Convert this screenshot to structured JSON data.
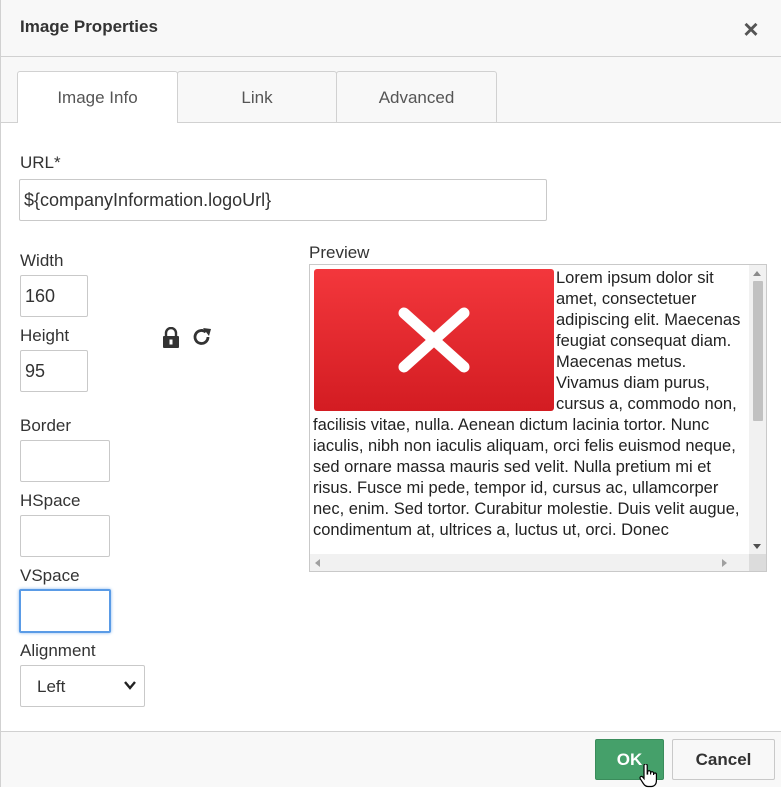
{
  "dialog": {
    "title": "Image Properties",
    "close_symbol": "×"
  },
  "tabs": [
    {
      "label": "Image Info",
      "active": true
    },
    {
      "label": "Link",
      "active": false
    },
    {
      "label": "Advanced",
      "active": false
    }
  ],
  "form": {
    "url_label": "URL",
    "url_required_mark": "*",
    "url_value": "${companyInformation.logoUrl}",
    "width_label": "Width",
    "width_value": "160",
    "height_label": "Height",
    "height_value": "95",
    "border_label": "Border",
    "border_value": "",
    "hspace_label": "HSpace",
    "hspace_value": "",
    "vspace_label": "VSpace",
    "vspace_value": "",
    "alignment_label": "Alignment",
    "alignment_value": "Left",
    "lock_icon": "lock-icon",
    "reset_icon": "reset-size-icon"
  },
  "preview": {
    "label": "Preview",
    "image_icon": "broken-image-x-icon",
    "text": "Lorem ipsum dolor sit amet, consectetuer adipiscing elit. Maecenas feugiat consequat diam. Maecenas metus. Vivamus diam purus, cursus a, commodo non, facilisis vitae, nulla. Aenean dictum lacinia tortor. Nunc iaculis, nibh non iaculis aliquam, orci felis euismod neque, sed ornare massa mauris sed velit. Nulla pretium mi et risus. Fusce mi pede, tempor id, cursus ac, ullamcorper nec, enim. Sed tortor. Curabitur molestie. Duis velit augue, condimentum at, ultrices a, luctus ut, orci. Donec"
  },
  "footer": {
    "ok_label": "OK",
    "cancel_label": "Cancel"
  },
  "colors": {
    "ok_button": "#45a06a",
    "focus_ring": "#5a9be6",
    "preview_image": "#e02127"
  }
}
